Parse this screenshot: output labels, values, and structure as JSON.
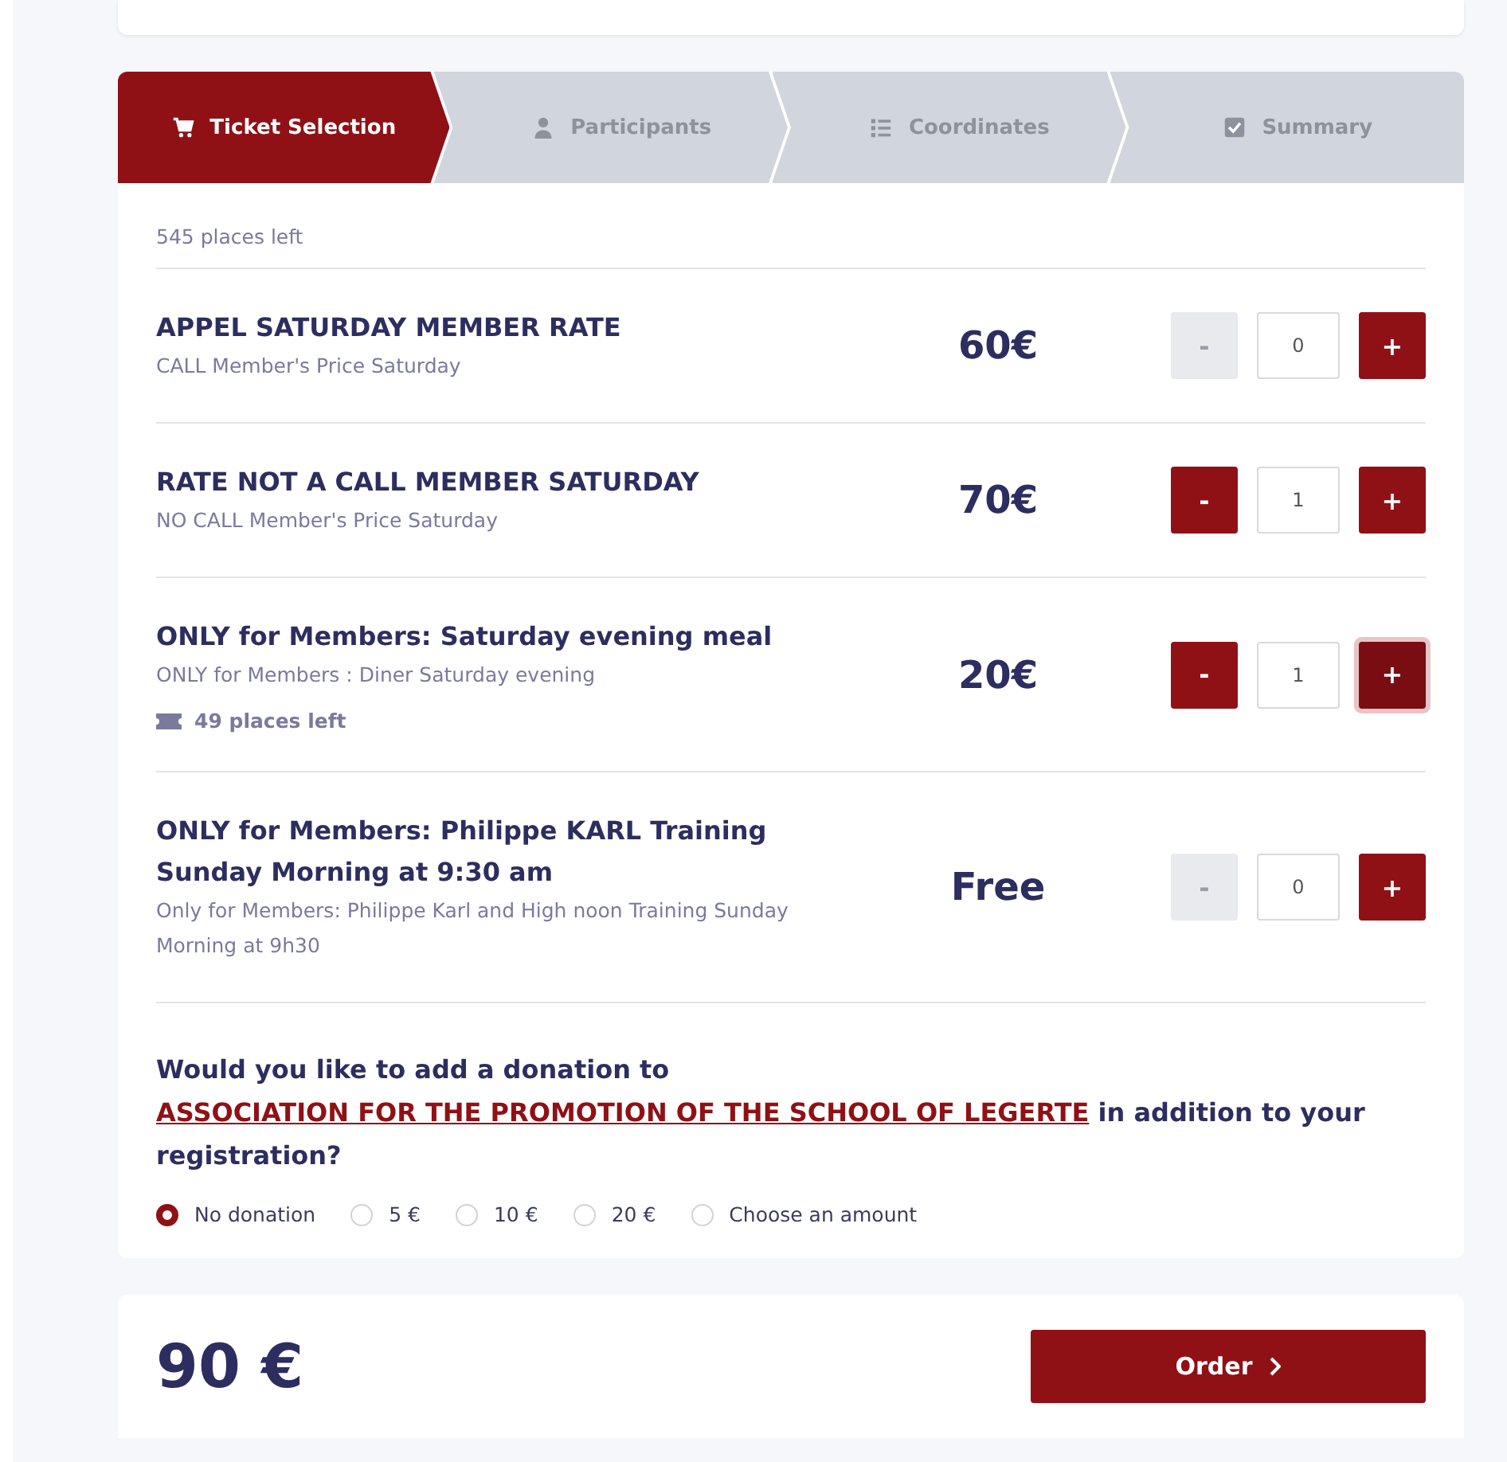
{
  "steps": [
    {
      "label": "Ticket Selection",
      "selected": true
    },
    {
      "label": "Participants",
      "selected": false
    },
    {
      "label": "Coordinates",
      "selected": false
    },
    {
      "label": "Summary",
      "selected": false
    }
  ],
  "places_left": "545 places left",
  "tickets": [
    {
      "name": "APPEL SATURDAY MEMBER RATE",
      "description": "CALL Member's Price Saturday",
      "price": "60€",
      "minus": "-",
      "quantity": "0",
      "plus": "+",
      "minus_enabled": false,
      "plus_focused": false
    },
    {
      "name": "RATE NOT A CALL MEMBER SATURDAY",
      "description": "NO CALL Member's Price Saturday",
      "price": "70€",
      "minus": "-",
      "quantity": "1",
      "plus": "+",
      "minus_enabled": true,
      "plus_focused": false
    },
    {
      "name": "ONLY for Members: Saturday evening meal",
      "description": "ONLY for Members : Diner Saturday evening",
      "remaining": "49 places left",
      "price": "20€",
      "minus": "-",
      "quantity": "1",
      "plus": "+",
      "minus_enabled": true,
      "plus_focused": true
    },
    {
      "name": "ONLY for Members: Philippe KARL Training Sunday Morning at 9:30 am",
      "description": "Only for Members: Philippe Karl and High noon Training Sunday Morning at 9h30",
      "price": "Free",
      "minus": "-",
      "quantity": "0",
      "plus": "+",
      "minus_enabled": false,
      "plus_focused": false
    }
  ],
  "donation": {
    "question_start": "Would you like to add a donation to",
    "link": "ASSOCIATION FOR THE PROMOTION OF THE SCHOOL OF LEGERTE",
    "question_end": "in addition to your registration?",
    "options": [
      {
        "label": "No donation",
        "selected": true
      },
      {
        "label": "5 €",
        "selected": false
      },
      {
        "label": "10 €",
        "selected": false
      },
      {
        "label": "20 €",
        "selected": false
      },
      {
        "label": "Choose an amount",
        "selected": false
      }
    ]
  },
  "total": "90 €",
  "order_button": "Order"
}
